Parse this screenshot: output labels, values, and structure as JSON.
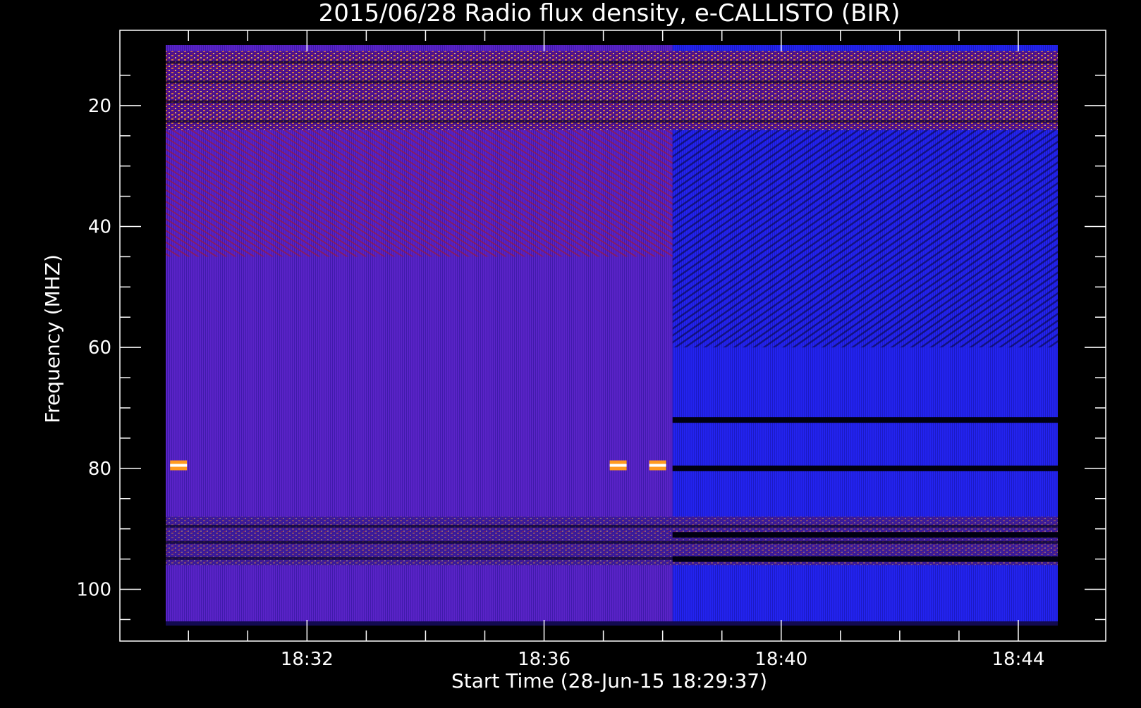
{
  "chart_data": {
    "type": "heatmap",
    "title": "2015/06/28  Radio flux density, e-CALLISTO (BIR)",
    "xlabel": "Start Time (28-Jun-15 18:29:37)",
    "ylabel": "Frequency (MHZ)",
    "x_range": [
      "18:29:37",
      "18:44:40"
    ],
    "y_range": [
      106,
      10
    ],
    "y_inverted": true,
    "x_ticks": [
      "18:32",
      "18:36",
      "18:40",
      "18:44"
    ],
    "y_ticks": [
      20,
      40,
      60,
      80,
      100
    ],
    "colormap": [
      "#000000",
      "#1a1aa0",
      "#2020ff",
      "#8a1a6e",
      "#d02010",
      "#ff8000",
      "#ffff66",
      "#ffffff"
    ],
    "grid": false,
    "receiver_change_time": "18:38:10",
    "features": [
      {
        "kind": "interference-band",
        "freq_range": [
          11,
          24
        ],
        "time_range": [
          "18:29:37",
          "18:44:40"
        ],
        "intensity": "high"
      },
      {
        "kind": "interference-band",
        "freq_range": [
          88,
          96
        ],
        "time_range": [
          "18:29:37",
          "18:44:40"
        ],
        "intensity": "medium"
      },
      {
        "kind": "dark-band",
        "freq": 72,
        "time_range": [
          "18:38:10",
          "18:44:40"
        ]
      },
      {
        "kind": "dark-band",
        "freq": 80,
        "time_range": [
          "18:38:10",
          "18:44:40"
        ]
      },
      {
        "kind": "dark-band",
        "freq": 91,
        "time_range": [
          "18:38:10",
          "18:44:40"
        ]
      },
      {
        "kind": "dark-band",
        "freq": 95,
        "time_range": [
          "18:38:10",
          "18:44:40"
        ]
      },
      {
        "kind": "bright-spot",
        "freq": 79.5,
        "time": "18:29:50"
      },
      {
        "kind": "bright-spot",
        "freq": 79.5,
        "time": "18:37:15"
      },
      {
        "kind": "bright-spot",
        "freq": 79.5,
        "time": "18:37:55"
      }
    ]
  }
}
